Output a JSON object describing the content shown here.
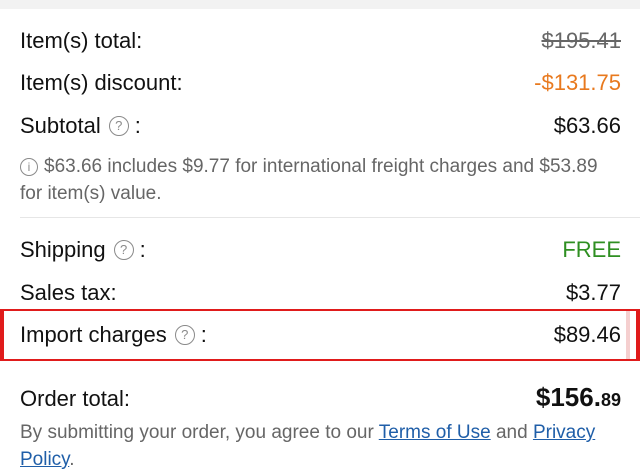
{
  "summary": {
    "items_total": {
      "label": "Item(s) total:",
      "value": "$195.41"
    },
    "items_discount": {
      "label": "Item(s) discount:",
      "value": "-$131.75"
    },
    "subtotal": {
      "label": "Subtotal",
      "colon": ":",
      "value": "$63.66",
      "help_icon": "question-circle-icon"
    },
    "note": {
      "icon": "info-circle-icon",
      "text": "$63.66 includes $9.77 for international freight charges and $53.89 for item(s) value."
    },
    "shipping": {
      "label": "Shipping",
      "colon": ":",
      "value": "FREE",
      "help_icon": "question-circle-icon"
    },
    "sales_tax": {
      "label": "Sales tax:",
      "value": "$3.77"
    },
    "import_charges": {
      "label": "Import charges",
      "colon": ":",
      "value": "$89.46",
      "help_icon": "question-circle-icon"
    },
    "order_total": {
      "label": "Order total:",
      "value_main": "$156.",
      "value_cents": "89"
    }
  },
  "legal": {
    "prefix": "By submitting your order, you agree to our ",
    "terms_link": "Terms of Use",
    "middle": " and ",
    "privacy_link": "Privacy Policy",
    "suffix": "."
  },
  "colors": {
    "discount": "#e8791e",
    "free": "#2f8f22",
    "highlight_border": "#e01b1b",
    "link": "#1f5ea8"
  }
}
